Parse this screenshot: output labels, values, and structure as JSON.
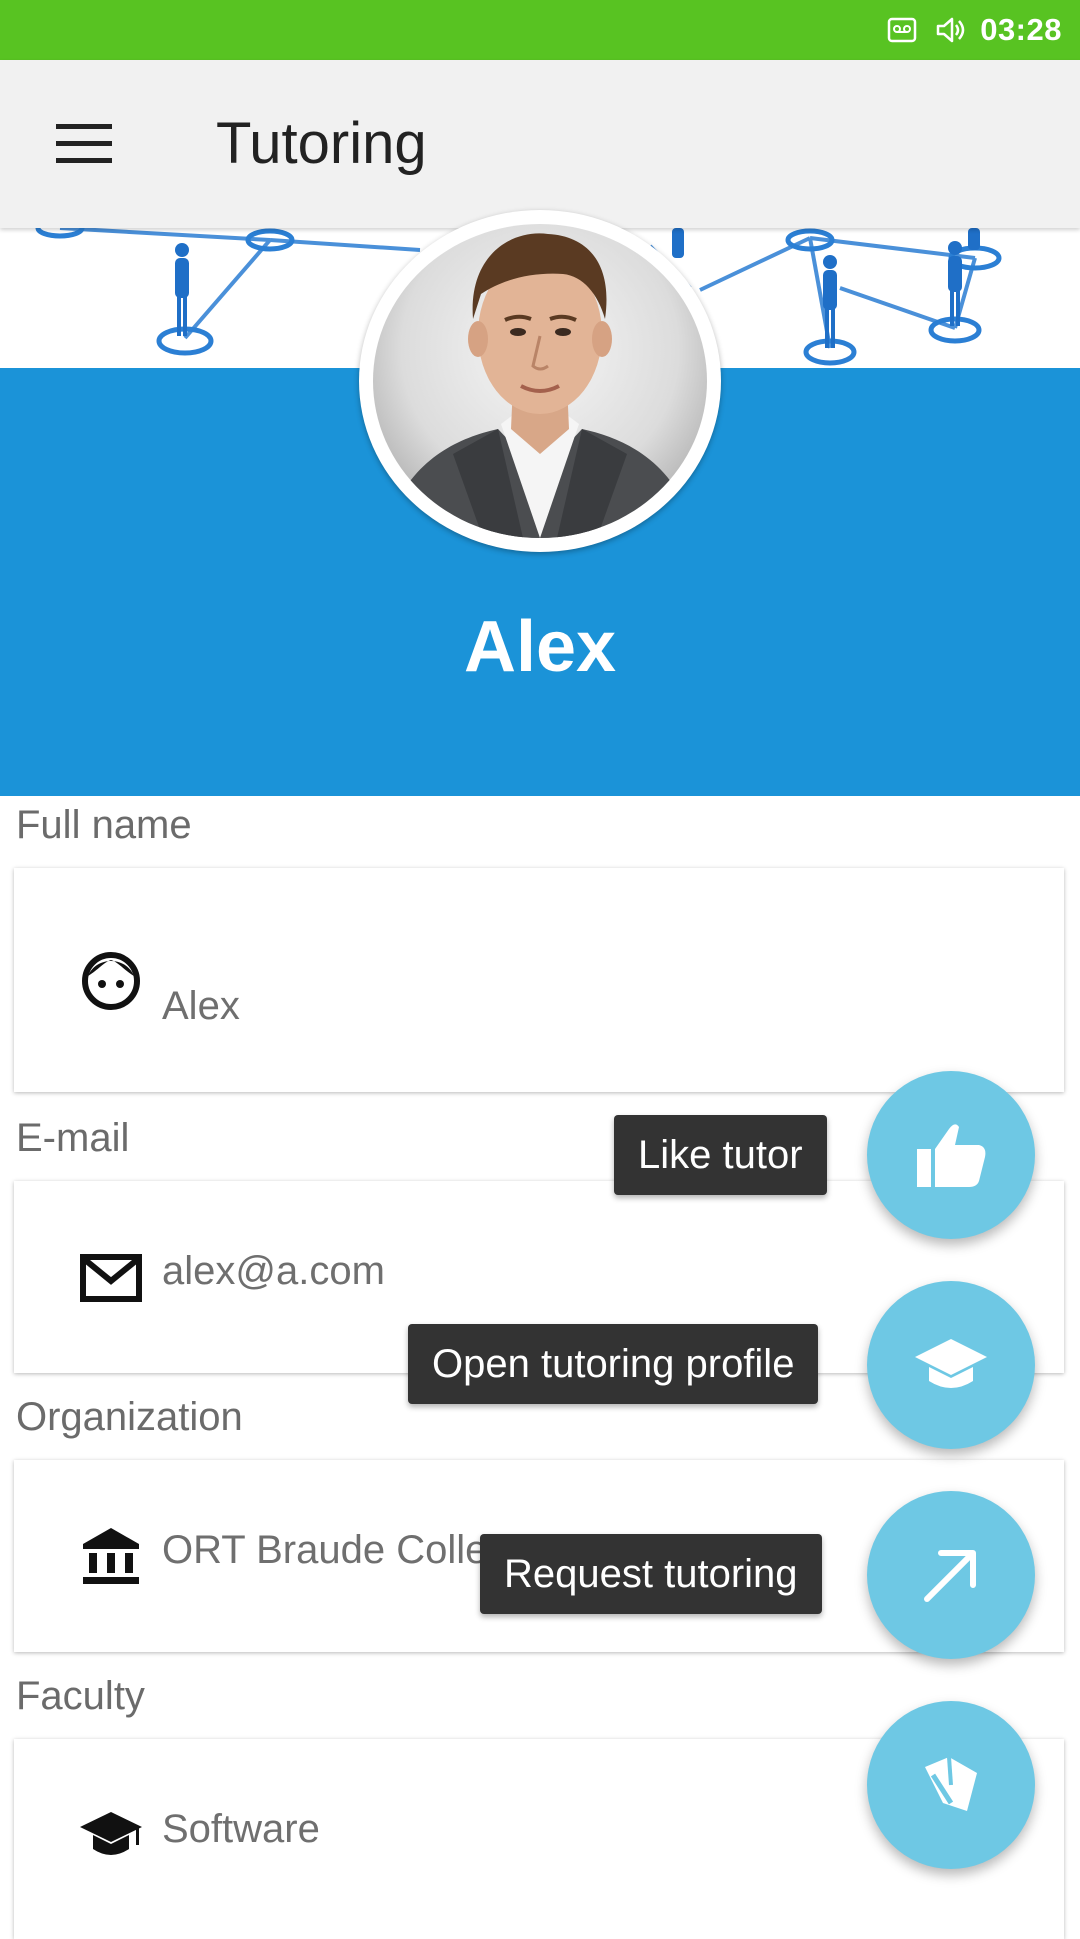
{
  "status_bar": {
    "time": "03:28",
    "icons": [
      "voicemail-icon",
      "volume-icon"
    ],
    "background": "#58c322"
  },
  "app_bar": {
    "title": "Tutoring",
    "menu_icon": "hamburger-menu-icon"
  },
  "profile": {
    "name": "Alex",
    "accent": "#1b93d8"
  },
  "fields": [
    {
      "label": "Full name",
      "value": "Alex",
      "icon": "face-icon"
    },
    {
      "label": "E-mail",
      "value": "alex@a.com",
      "icon": "mail-icon"
    },
    {
      "label": "Organization",
      "value": "ORT Braude College",
      "icon": "institution-icon"
    },
    {
      "label": "Faculty",
      "value": "Software",
      "icon": "graduation-cap-icon"
    }
  ],
  "fab_menu": {
    "color": "#6ec8e4",
    "actions": [
      {
        "label": "Like tutor",
        "icon": "thumbs-up-icon"
      },
      {
        "label": "Open tutoring profile",
        "icon": "school-icon"
      },
      {
        "label": "Request tutoring",
        "icon": "arrow-up-right-icon"
      }
    ],
    "main_icon": "book-open-icon"
  }
}
